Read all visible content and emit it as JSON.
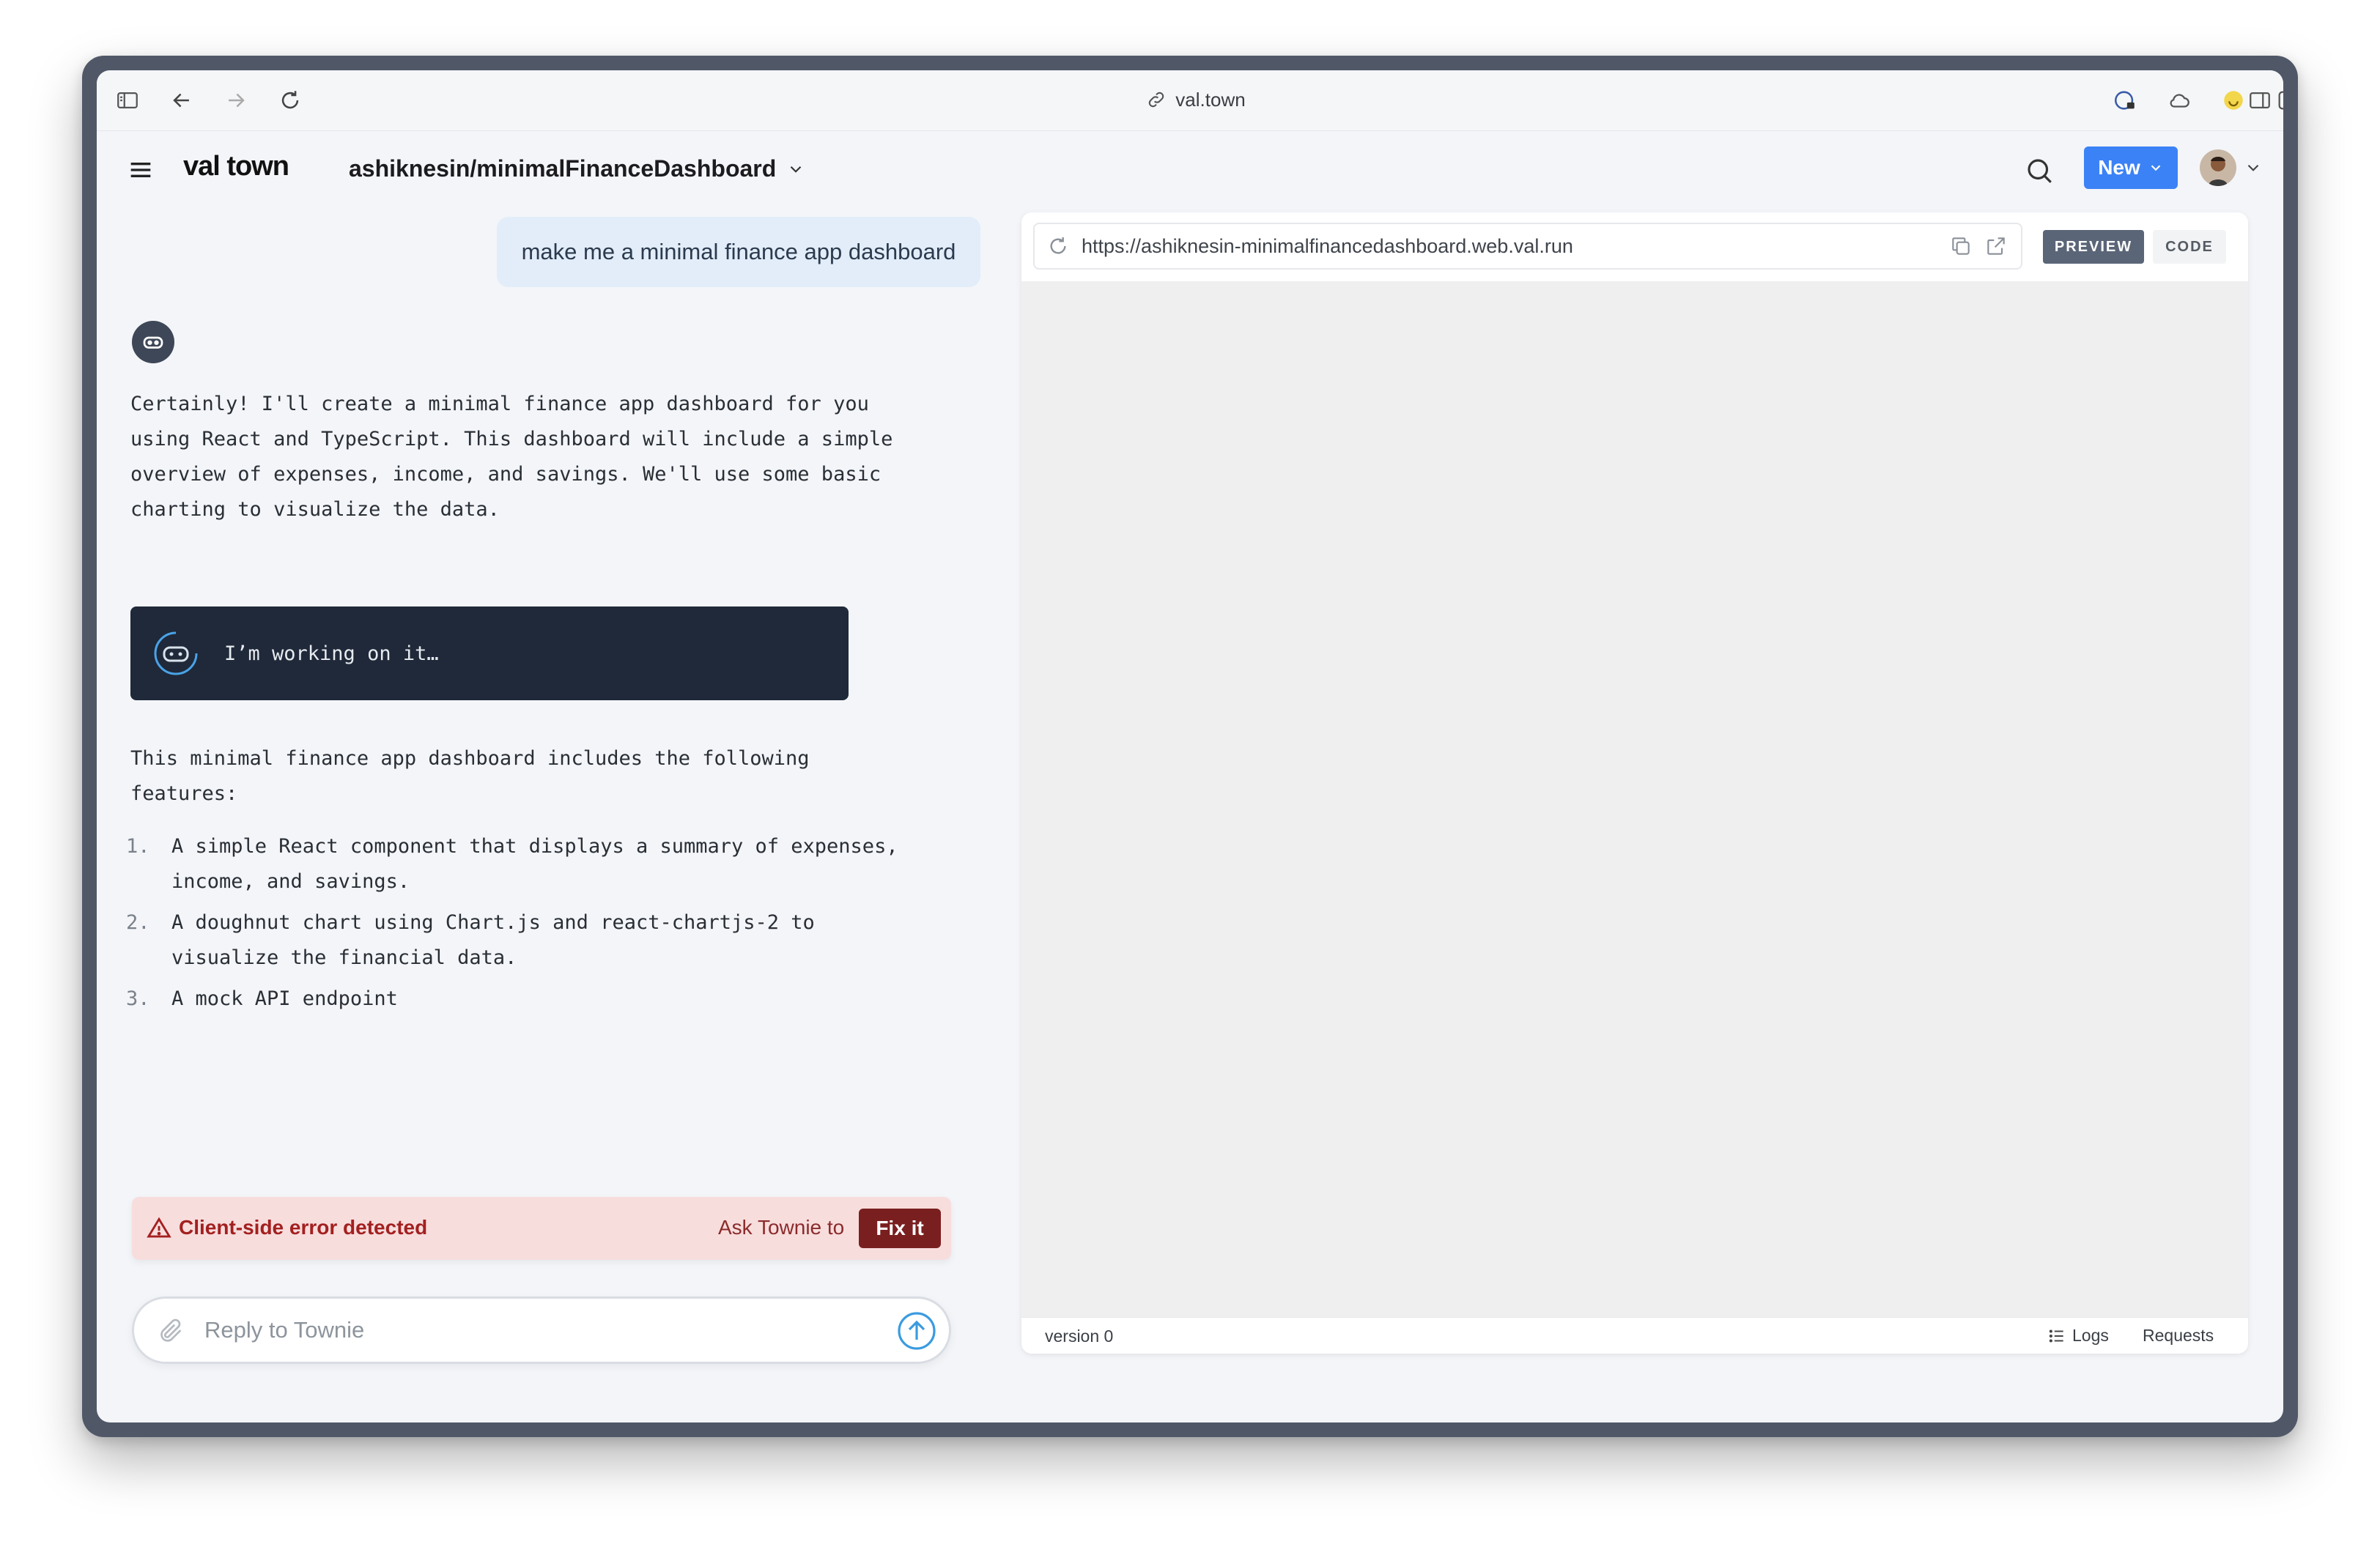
{
  "browser": {
    "address": "val.town"
  },
  "nav": {
    "brand": "val town",
    "project": "ashiknesin/minimalFinanceDashboard",
    "new_label": "New"
  },
  "chat": {
    "user_message": "make me a minimal finance app dashboard",
    "intro_lines": [
      "Certainly! I'll create a minimal finance app dashboard for you",
      "using React and TypeScript. This dashboard will include a simple",
      "overview of expenses, income, and savings. We'll use some basic",
      "charting to visualize the data."
    ],
    "working_text": "I’m working on it…",
    "summary_lines": [
      "This minimal finance app dashboard includes the following",
      "features:"
    ],
    "features": [
      {
        "num": "1.",
        "lines": [
          "A simple React component that displays a summary of expenses,",
          "income, and savings."
        ]
      },
      {
        "num": "2.",
        "lines": [
          "A doughnut chart using Chart.js and react-chartjs-2 to",
          "visualize the financial data."
        ]
      },
      {
        "num": "3.",
        "lines": [
          "A mock API endpoint"
        ]
      }
    ]
  },
  "error": {
    "message": "Client-side error detected",
    "ask_text": "Ask Townie to",
    "fix_label": "Fix it"
  },
  "reply": {
    "placeholder": "Reply to Townie"
  },
  "preview": {
    "url": "https://ashiknesin-minimalfinancedashboard.web.val.run",
    "preview_tab": "PREVIEW",
    "code_tab": "CODE",
    "version": "version 0",
    "logs_label": "Logs",
    "requests_label": "Requests"
  },
  "colors": {
    "accent": "#3b82f6",
    "error_bg": "#f8dddd",
    "fix_button": "#7a1f1f",
    "working_bg": "#1f2939"
  }
}
